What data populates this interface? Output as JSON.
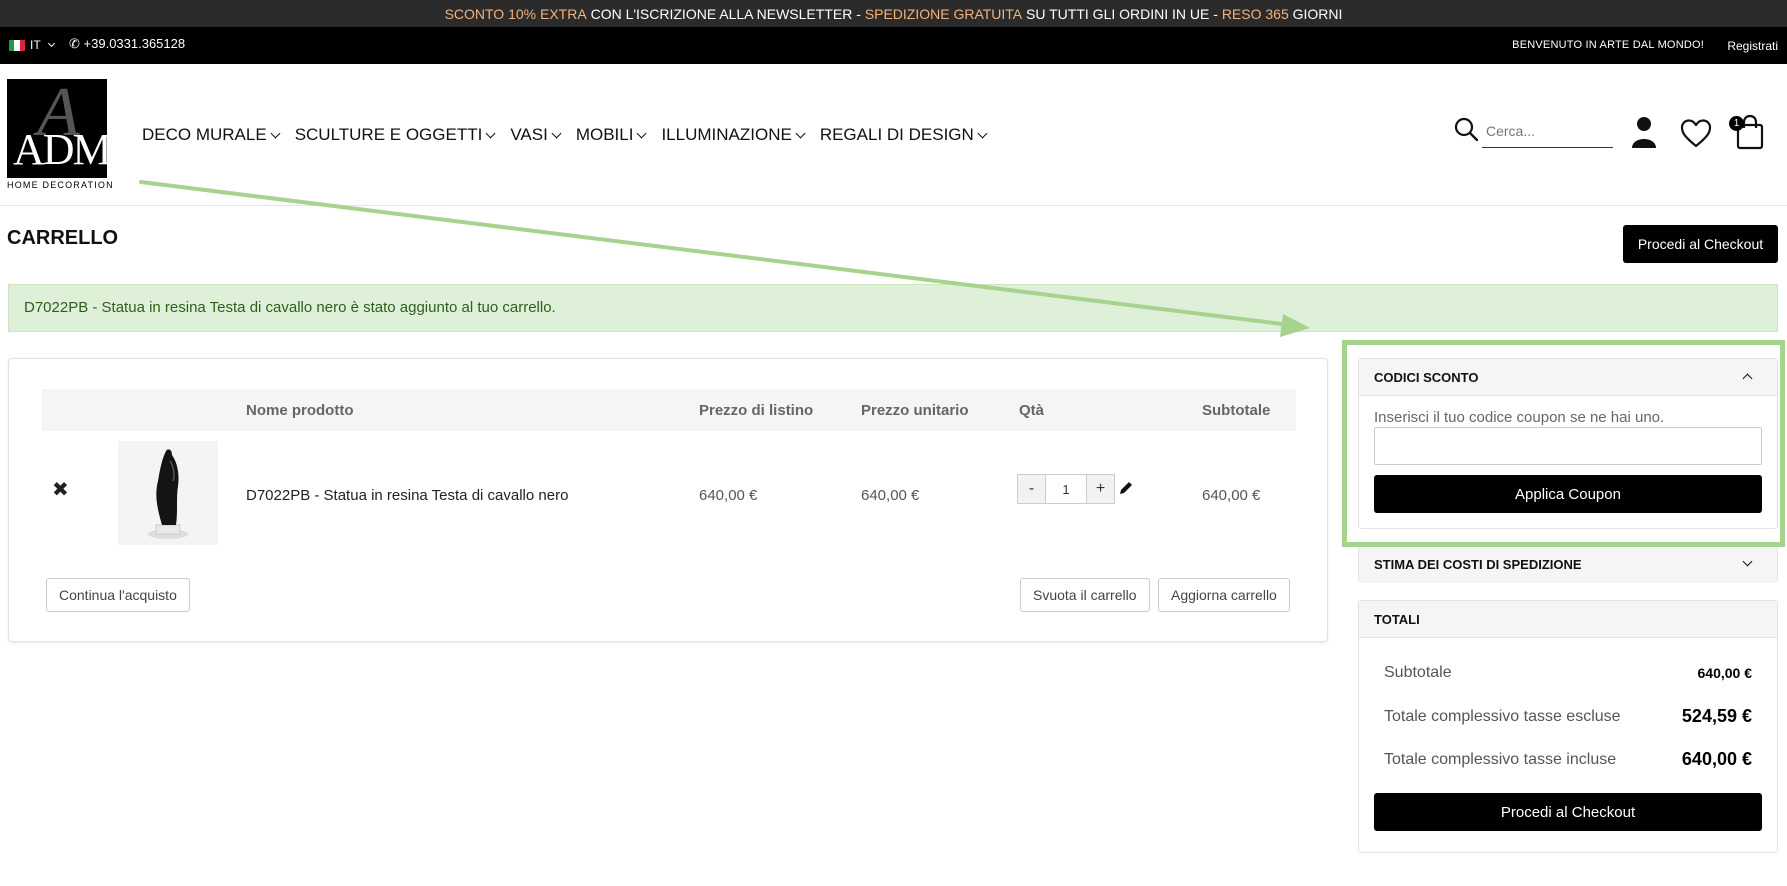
{
  "promo": {
    "part1": "SCONTO 10% EXTRA",
    "part2": " CON L'ISCRIZIONE ALLA NEWSLETTER - ",
    "part3": "SPEDIZIONE GRATUITA",
    "part4": " SU TUTTI GLI ORDINI IN UE - ",
    "part5": "RESO 365",
    "part6": " GIORNI"
  },
  "topbar": {
    "language": "IT",
    "phone": "+39.0331.365128",
    "welcome": "BENVENUTO IN ARTE DAL MONDO!",
    "register": "Registrati"
  },
  "logo": {
    "mark": "ADM",
    "letter": "A",
    "subtitle": "HOME DECORATION"
  },
  "nav": [
    {
      "label": "DECO MURALE"
    },
    {
      "label": "SCULTURE E OGGETTI"
    },
    {
      "label": "VASI"
    },
    {
      "label": "MOBILI"
    },
    {
      "label": "ILLUMINAZIONE"
    },
    {
      "label": "REGALI DI DESIGN"
    }
  ],
  "search": {
    "placeholder": "Cerca..."
  },
  "cart_count": "1",
  "page": {
    "title": "CARRELLO",
    "checkout_top": "Procedi al Checkout",
    "alert": "D7022PB - Statua in resina Testa di cavallo nero è stato aggiunto al tuo carrello."
  },
  "table": {
    "headers": {
      "name": "Nome prodotto",
      "list_price": "Prezzo di listino",
      "unit_price": "Prezzo unitario",
      "qty": "Qtà",
      "subtotal": "Subtotale"
    },
    "row": {
      "name": "D7022PB - Statua in resina Testa di cavallo nero",
      "list_price": "640,00 €",
      "unit_price": "640,00 €",
      "qty": "1",
      "subtotal": "640,00 €"
    },
    "continue": "Continua l'acquisto",
    "empty": "Svuota il carrello",
    "update": "Aggiorna carrello"
  },
  "coupon": {
    "title": "CODICI SCONTO",
    "hint": "Inserisci il tuo codice coupon se ne hai uno.",
    "apply": "Applica Coupon"
  },
  "shipping": {
    "title": "STIMA DEI COSTI DI SPEDIZIONE"
  },
  "totals": {
    "title": "TOTALI",
    "subtotal_label": "Subtotale",
    "subtotal_value": "640,00 €",
    "excl_label": "Totale complessivo tasse escluse",
    "excl_value": "524,59 €",
    "incl_label": "Totale complessivo tasse incluse",
    "incl_value": "640,00 €",
    "checkout": "Procedi al Checkout"
  },
  "colors": {
    "accent_promo": "#f2b27c",
    "success_bg": "#dff0d8",
    "annotation": "#a6d38e"
  }
}
